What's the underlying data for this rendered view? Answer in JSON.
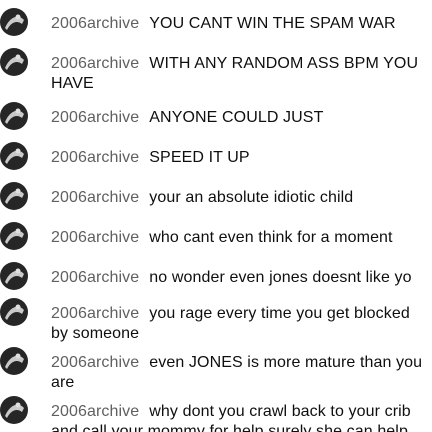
{
  "messages": [
    {
      "author": "2006archive",
      "text": "YOU CANT WIN THE SPAM WAR"
    },
    {
      "author": "2006archive",
      "text": "WITH ANY RANDOM ASS BPM YOU HAVE"
    },
    {
      "author": "2006archive",
      "text": "ANYONE COULD JUST"
    },
    {
      "author": "2006archive",
      "text": "SPEED IT UP"
    },
    {
      "author": "2006archive",
      "text": "your an absolute idiotic child"
    },
    {
      "author": "2006archive",
      "text": "who cant even think for a moment"
    },
    {
      "author": "2006archive",
      "text": "no wonder even jones doesnt like yo"
    },
    {
      "author": "2006archive",
      "text": "you rage every time you get blocked by someone"
    },
    {
      "author": "2006archive",
      "text": "even JONES is more mature than you are"
    },
    {
      "author": "2006archive",
      "text": "why dont you crawl back to your crib and call your mommy for help surely she can help"
    }
  ],
  "colors": {
    "author": "#606060",
    "text": "#0f0f0f",
    "avatar_dark": "#262626",
    "avatar_light": "#bdbdbd"
  },
  "icons": {
    "avatar": "user-avatar-icon"
  }
}
